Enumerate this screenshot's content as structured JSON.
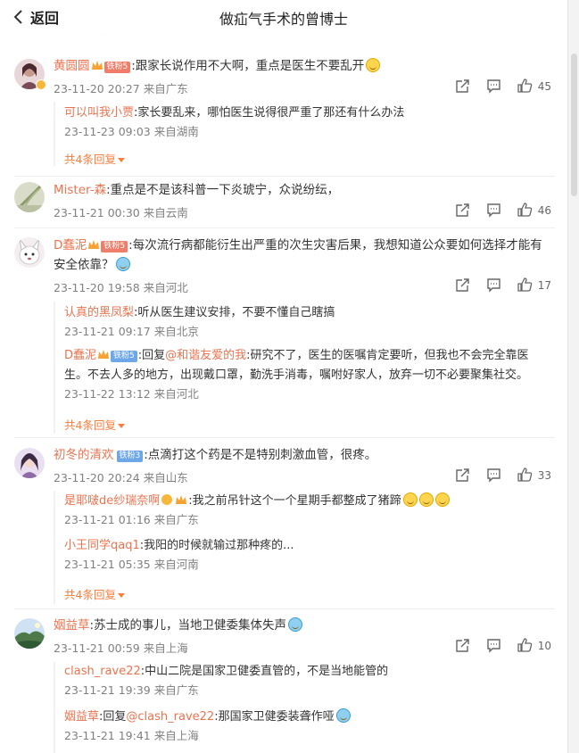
{
  "header": {
    "back_label": "返回",
    "title": "做疝气手术的曾博士"
  },
  "cutoff_text": "共4条回复",
  "comments": [
    {
      "username": "黄圆圆",
      "fan_label": "铁粉5",
      "text": ":跟家长说作用不大啊，重点是医生不要乱开",
      "meta": "23-11-20 20:27 来自广东",
      "likes": "45",
      "replies": [
        {
          "username": "可以叫我小贾",
          "text": ":家长要乱来，哪怕医生说得很严重了那还有什么办法",
          "meta": "23-11-23 09:03 来自湖南"
        }
      ],
      "more_label": "共4条回复"
    },
    {
      "username": "Mister-森",
      "text": ":重点是不是该科普一下炎琥宁，众说纷纭，",
      "meta": "23-11-21 00:30 来自云南",
      "likes": "46"
    },
    {
      "username": "D蠢泥",
      "fan_label": "铁粉5",
      "text": ":每次流行病都能衍生出严重的次生灾害后果，我想知道公众要如何选择才能有安全依靠？",
      "meta": "23-11-20 19:58 来自河北",
      "likes": "17",
      "replies": [
        {
          "username": "认真的黑凤梨",
          "text": ":听从医生建议安排，不要不懂自己瞎搞",
          "meta": "23-11-21 09:17 来自北京"
        },
        {
          "username": "D蠢泥",
          "fan_label": "铁粉5",
          "reply_prefix": ":回复",
          "reply_to": "@和谐友爱的我",
          "text": ":研究不了，医生的医嘱肯定要听，但我也不会完全靠医生。不去人多的地方，出现戴口罩，勤洗手消毒，嘱咐好家人，放弃一切不必要聚集社交。",
          "meta": "23-11-22 13:12 来自河北"
        }
      ],
      "more_label": "共4条回复"
    },
    {
      "username": "初冬的清欢",
      "fan_label": "铁粉3",
      "text": ":点滴打这个药是不是特别刺激血管，很疼。",
      "meta": "23-11-20 20:24 来自山东",
      "likes": "33",
      "replies": [
        {
          "username": "是耶啵de纱瑞奈啊",
          "text": ":我之前吊针这个一个星期手都整成了猪蹄",
          "meta": "23-11-21 01:16 来自广东"
        },
        {
          "username": "小王同学qaq1",
          "text": ":我阳的时候就输过那种疼的...",
          "meta": "23-11-21 05:35 来自河南"
        }
      ],
      "more_label": "共4条回复"
    },
    {
      "username": "姻益草",
      "text": ":苏士成的事儿，当地卫健委集体失声",
      "meta": "23-11-21 00:59 来自上海",
      "likes": "10",
      "replies": [
        {
          "username": "clash_rave22",
          "text": ":中山二院是国家卫健委直管的，不是当地能管的",
          "meta": "23-11-21 19:39 来自广东"
        },
        {
          "username": "姻益草",
          "reply_prefix": ":回复",
          "reply_to": "@clash_rave22",
          "text": ":那国家卫健委装聋作哑",
          "meta": "23-11-21 19:41 来自上海"
        }
      ]
    }
  ],
  "colors": {
    "username": "#eb7350",
    "more": "#fa7d3c",
    "meta": "#808080",
    "text": "#333333"
  },
  "icons": [
    "chevron-left-icon",
    "share-icon",
    "comment-icon",
    "like-icon"
  ]
}
